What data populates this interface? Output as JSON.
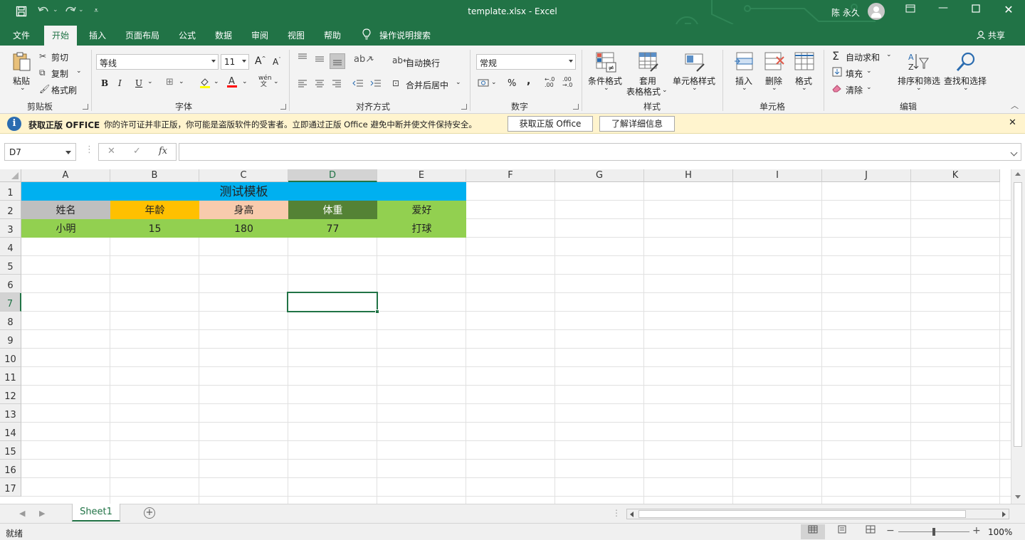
{
  "titlebar": {
    "title": "template.xlsx  -  Excel",
    "user": "陈 永久",
    "customize": "⩡"
  },
  "tabs": [
    {
      "label": "文件"
    },
    {
      "label": "开始"
    },
    {
      "label": "插入"
    },
    {
      "label": "页面布局"
    },
    {
      "label": "公式"
    },
    {
      "label": "数据"
    },
    {
      "label": "审阅"
    },
    {
      "label": "视图"
    },
    {
      "label": "帮助"
    },
    {
      "label": "操作说明搜索"
    }
  ],
  "share_label": "共享",
  "ribbon": {
    "clipboard": {
      "paste": "粘贴",
      "cut": "剪切",
      "copy": "复制",
      "format_painter": "格式刷",
      "label": "剪贴板"
    },
    "font": {
      "name": "等线",
      "size": "11",
      "bold": "B",
      "italic": "I",
      "underline": "U",
      "label": "字体"
    },
    "alignment": {
      "wrap": "自动换行",
      "merge": "合并后居中",
      "label": "对齐方式"
    },
    "number": {
      "format": "常规",
      "percent": "%",
      "comma": ",",
      "label": "数字"
    },
    "styles": {
      "conditional": "条件格式",
      "table_line1": "套用",
      "table_line2": "表格格式",
      "cell_styles": "单元格样式",
      "label": "样式"
    },
    "cells": {
      "insert": "插入",
      "delete": "删除",
      "format": "格式",
      "label": "单元格"
    },
    "editing": {
      "autosum": "自动求和",
      "fill": "填充",
      "clear": "清除",
      "sort": "排序和筛选",
      "find": "查找和选择",
      "label": "编辑"
    }
  },
  "msgbar": {
    "title": "获取正版 OFFICE",
    "text": "你的许可证并非正版，你可能是盗版软件的受害者。立即通过正版 Office 避免中断并使文件保持安全。",
    "btn1": "获取正版 Office",
    "btn2": "了解详细信息"
  },
  "formula_bar": {
    "name_box": "D7",
    "value": ""
  },
  "grid": {
    "columns": [
      "A",
      "B",
      "C",
      "D",
      "E",
      "F",
      "G",
      "H",
      "I",
      "J",
      "K"
    ],
    "rows": [
      "1",
      "2",
      "3",
      "4",
      "5",
      "6",
      "7",
      "8",
      "9",
      "10",
      "11",
      "12",
      "13",
      "14",
      "15",
      "16",
      "17"
    ],
    "selected_cell": "D7",
    "merged_title": {
      "text": "测试模板",
      "bg": "#00b0f0"
    },
    "header_row": [
      {
        "text": "姓名",
        "bg": "#bfbfbf",
        "color": "#222222"
      },
      {
        "text": "年龄",
        "bg": "#ffc000",
        "color": "#222222"
      },
      {
        "text": "身高",
        "bg": "#f8cbad",
        "color": "#222222"
      },
      {
        "text": "体重",
        "bg": "#548235",
        "color": "#ffffff"
      },
      {
        "text": "爱好",
        "bg": "#92d050",
        "color": "#222222"
      }
    ],
    "data_row": [
      {
        "text": "小明",
        "bg": "#92d050"
      },
      {
        "text": "15",
        "bg": "#92d050"
      },
      {
        "text": "180",
        "bg": "#92d050"
      },
      {
        "text": "77",
        "bg": "#92d050"
      },
      {
        "text": "打球",
        "bg": "#92d050"
      }
    ]
  },
  "sheets": [
    {
      "name": "Sheet1"
    }
  ],
  "status": {
    "ready": "就绪",
    "zoom": "100%"
  },
  "colors": {
    "accent": "#217346"
  }
}
